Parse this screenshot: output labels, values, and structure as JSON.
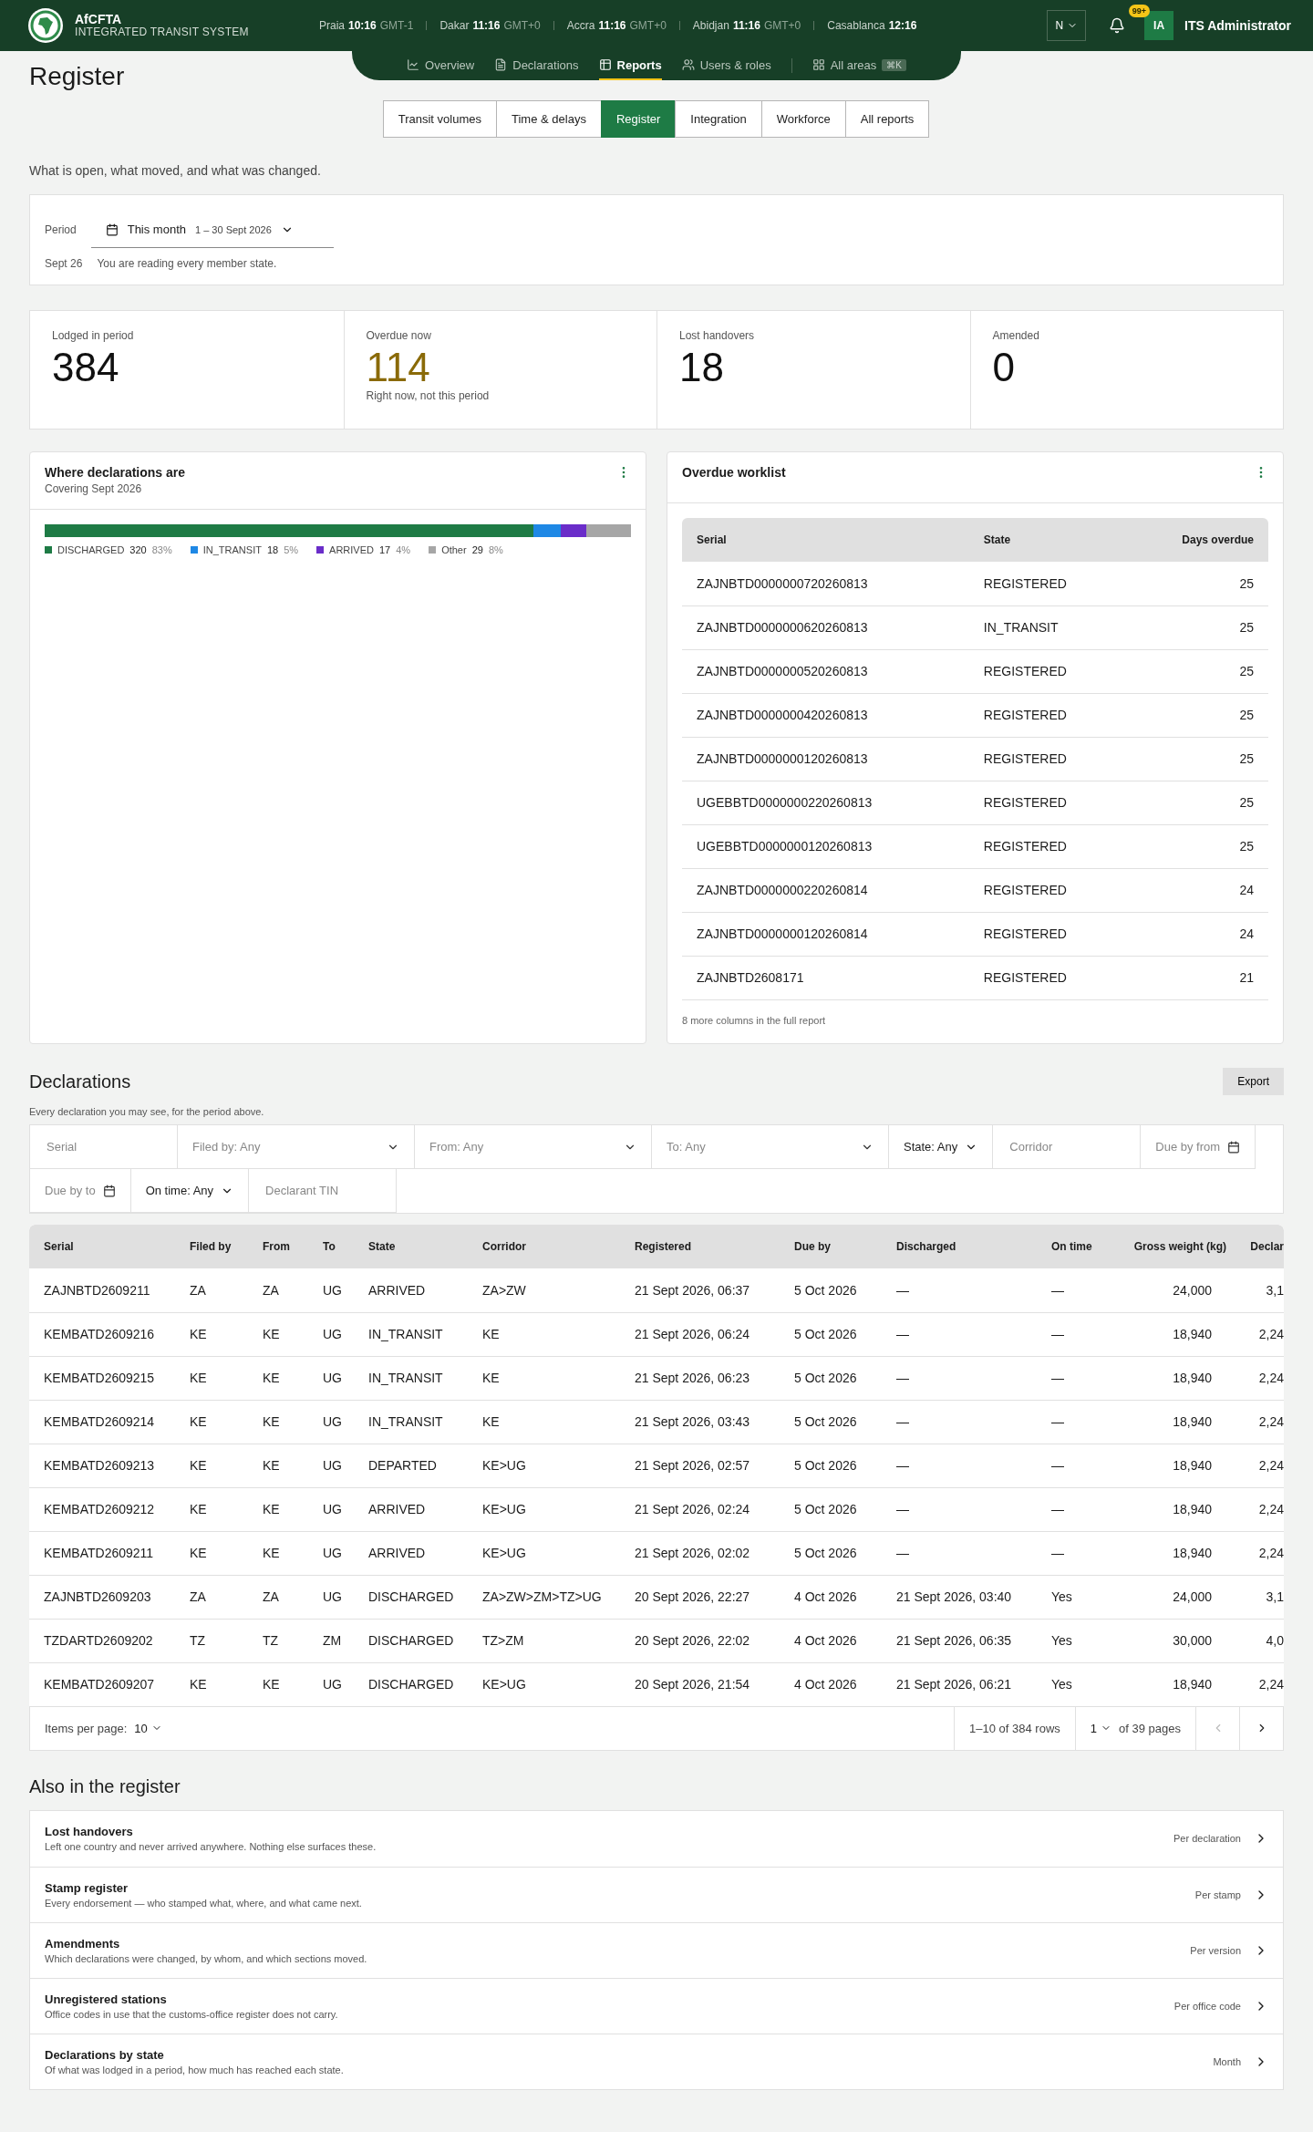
{
  "header": {
    "brand": "AfCFTA",
    "subtitle": "INTEGRATED TRANSIT SYSTEM",
    "clocks": [
      {
        "city": "Praia",
        "time": "10:16",
        "zone": "GMT-1"
      },
      {
        "city": "Dakar",
        "time": "11:16",
        "zone": "GMT+0"
      },
      {
        "city": "Accra",
        "time": "11:16",
        "zone": "GMT+0"
      },
      {
        "city": "Abidjan",
        "time": "11:16",
        "zone": "GMT+0"
      },
      {
        "city": "Casablanca",
        "time": "12:16"
      }
    ],
    "language": "N",
    "notifications": "99+",
    "user": {
      "initials": "IA",
      "name": "ITS Administrator"
    }
  },
  "nav": [
    {
      "label": "Overview",
      "selected": false
    },
    {
      "label": "Declarations",
      "selected": false
    },
    {
      "label": "Reports",
      "selected": true
    },
    {
      "label": "Users & roles",
      "selected": false
    },
    {
      "label": "All areas",
      "shortcut": "⌘K",
      "selected": false
    }
  ],
  "page_title": "Register",
  "report_tabs": [
    {
      "label": "Transit volumes",
      "selected": false
    },
    {
      "label": "Time & delays",
      "selected": false
    },
    {
      "label": "Register",
      "selected": true
    },
    {
      "label": "Integration",
      "selected": false
    },
    {
      "label": "Workforce",
      "selected": false
    },
    {
      "label": "All reports",
      "selected": false
    }
  ],
  "intro": "What is open, what moved, and what was changed.",
  "period": {
    "label": "Period",
    "value": "This month",
    "range": "1 – 30 Sept 2026",
    "date_note": "Sept 26",
    "note": "You are reading every member state."
  },
  "kpis": [
    {
      "label": "Lodged in period",
      "value": "384",
      "warning": false
    },
    {
      "label": "Overdue now",
      "value": "114",
      "note": "Right now, not this period",
      "warning": true
    },
    {
      "label": "Lost handovers",
      "value": "18",
      "warning": false
    },
    {
      "label": "Amended",
      "value": "0",
      "warning": false
    }
  ],
  "status_card": {
    "title": "Where declarations are",
    "subtitle": "Covering Sept 2026",
    "segments": [
      {
        "name": "DISCHARGED",
        "count": "320",
        "share": "83%",
        "color": "#1e7b45"
      },
      {
        "name": "IN_TRANSIT",
        "count": "18",
        "share": "5%",
        "color": "#1e88e5"
      },
      {
        "name": "ARRIVED",
        "count": "17",
        "share": "4%",
        "color": "#6a2dc9"
      },
      {
        "name": "Other",
        "count": "29",
        "share": "8%",
        "color": "#a6a6a6"
      }
    ]
  },
  "overdue": {
    "title": "Overdue worklist",
    "columns": [
      "Serial",
      "State",
      "Days overdue"
    ],
    "rows": [
      [
        "ZAJNBTD0000000720260813",
        "REGISTERED",
        "25"
      ],
      [
        "ZAJNBTD0000000620260813",
        "IN_TRANSIT",
        "25"
      ],
      [
        "ZAJNBTD0000000520260813",
        "REGISTERED",
        "25"
      ],
      [
        "ZAJNBTD0000000420260813",
        "REGISTERED",
        "25"
      ],
      [
        "ZAJNBTD0000000120260813",
        "REGISTERED",
        "25"
      ],
      [
        "UGEBBTD0000000220260813",
        "REGISTERED",
        "25"
      ],
      [
        "UGEBBTD0000000120260813",
        "REGISTERED",
        "25"
      ],
      [
        "ZAJNBTD0000000220260814",
        "REGISTERED",
        "24"
      ],
      [
        "ZAJNBTD0000000120260814",
        "REGISTERED",
        "24"
      ],
      [
        "ZAJNBTD2608171",
        "REGISTERED",
        "21"
      ]
    ],
    "footnote": "8 more columns in the full report"
  },
  "declarations": {
    "title": "Declarations",
    "export": "Export",
    "description": "Every declaration you may see, for the period above.",
    "filters": [
      {
        "kind": "input",
        "placeholder": "Serial"
      },
      {
        "kind": "dropdown",
        "placeholder": "Filed by: Any"
      },
      {
        "kind": "dropdown",
        "placeholder": "From: Any"
      },
      {
        "kind": "dropdown",
        "placeholder": "To: Any"
      },
      {
        "kind": "select",
        "value": "State: Any"
      },
      {
        "kind": "input",
        "placeholder": "Corridor"
      },
      {
        "kind": "date",
        "placeholder": "Due by from"
      },
      {
        "kind": "date",
        "placeholder": "Due by to"
      },
      {
        "kind": "select",
        "value": "On time: Any"
      },
      {
        "kind": "input",
        "placeholder": "Declarant TIN"
      }
    ],
    "columns": [
      "Serial",
      "Filed by",
      "From",
      "To",
      "State",
      "Corridor",
      "Registered",
      "Due by",
      "Discharged",
      "On time",
      "Gross weight (kg)",
      "Declar"
    ],
    "rows": [
      [
        "ZAJNBTD2609211",
        "ZA",
        "ZA",
        "UG",
        "ARRIVED",
        "ZA>ZW",
        "21 Sept 2026, 06:37",
        "5 Oct 2026",
        "—",
        "—",
        "24,000",
        "3,1"
      ],
      [
        "KEMBATD2609216",
        "KE",
        "KE",
        "UG",
        "IN_TRANSIT",
        "KE",
        "21 Sept 2026, 06:24",
        "5 Oct 2026",
        "—",
        "—",
        "18,940",
        "2,24"
      ],
      [
        "KEMBATD2609215",
        "KE",
        "KE",
        "UG",
        "IN_TRANSIT",
        "KE",
        "21 Sept 2026, 06:23",
        "5 Oct 2026",
        "—",
        "—",
        "18,940",
        "2,24"
      ],
      [
        "KEMBATD2609214",
        "KE",
        "KE",
        "UG",
        "IN_TRANSIT",
        "KE",
        "21 Sept 2026, 03:43",
        "5 Oct 2026",
        "—",
        "—",
        "18,940",
        "2,24"
      ],
      [
        "KEMBATD2609213",
        "KE",
        "KE",
        "UG",
        "DEPARTED",
        "KE>UG",
        "21 Sept 2026, 02:57",
        "5 Oct 2026",
        "—",
        "—",
        "18,940",
        "2,24"
      ],
      [
        "KEMBATD2609212",
        "KE",
        "KE",
        "UG",
        "ARRIVED",
        "KE>UG",
        "21 Sept 2026, 02:24",
        "5 Oct 2026",
        "—",
        "—",
        "18,940",
        "2,24"
      ],
      [
        "KEMBATD2609211",
        "KE",
        "KE",
        "UG",
        "ARRIVED",
        "KE>UG",
        "21 Sept 2026, 02:02",
        "5 Oct 2026",
        "—",
        "—",
        "18,940",
        "2,24"
      ],
      [
        "ZAJNBTD2609203",
        "ZA",
        "ZA",
        "UG",
        "DISCHARGED",
        "ZA>ZW>ZM>TZ>UG",
        "20 Sept 2026, 22:27",
        "4 Oct 2026",
        "21 Sept 2026, 03:40",
        "Yes",
        "24,000",
        "3,1"
      ],
      [
        "TZDARTD2609202",
        "TZ",
        "TZ",
        "ZM",
        "DISCHARGED",
        "TZ>ZM",
        "20 Sept 2026, 22:02",
        "4 Oct 2026",
        "21 Sept 2026, 06:35",
        "Yes",
        "30,000",
        "4,0"
      ],
      [
        "KEMBATD2609207",
        "KE",
        "KE",
        "UG",
        "DISCHARGED",
        "KE>UG",
        "20 Sept 2026, 21:54",
        "4 Oct 2026",
        "21 Sept 2026, 06:21",
        "Yes",
        "18,940",
        "2,24"
      ]
    ],
    "pagination": {
      "per_page_label": "Items per page:",
      "per_page": "10",
      "range": "1–10 of 384 rows",
      "page": "1",
      "pages": "of 39 pages",
      "prev_disabled": true,
      "next_disabled": false
    }
  },
  "also": {
    "title": "Also in the register",
    "items": [
      {
        "title": "Lost handovers",
        "description": "Left one country and never arrived anywhere. Nothing else surfaces these.",
        "meta": "Per declaration"
      },
      {
        "title": "Stamp register",
        "description": "Every endorsement — who stamped what, where, and what came next.",
        "meta": "Per stamp"
      },
      {
        "title": "Amendments",
        "description": "Which declarations were changed, by whom, and which sections moved.",
        "meta": "Per version"
      },
      {
        "title": "Unregistered stations",
        "description": "Office codes in use that the customs-office register does not carry.",
        "meta": "Per office code"
      },
      {
        "title": "Declarations by state",
        "description": "Of what was lodged in a period, how much has reached each state.",
        "meta": "Month"
      }
    ]
  }
}
